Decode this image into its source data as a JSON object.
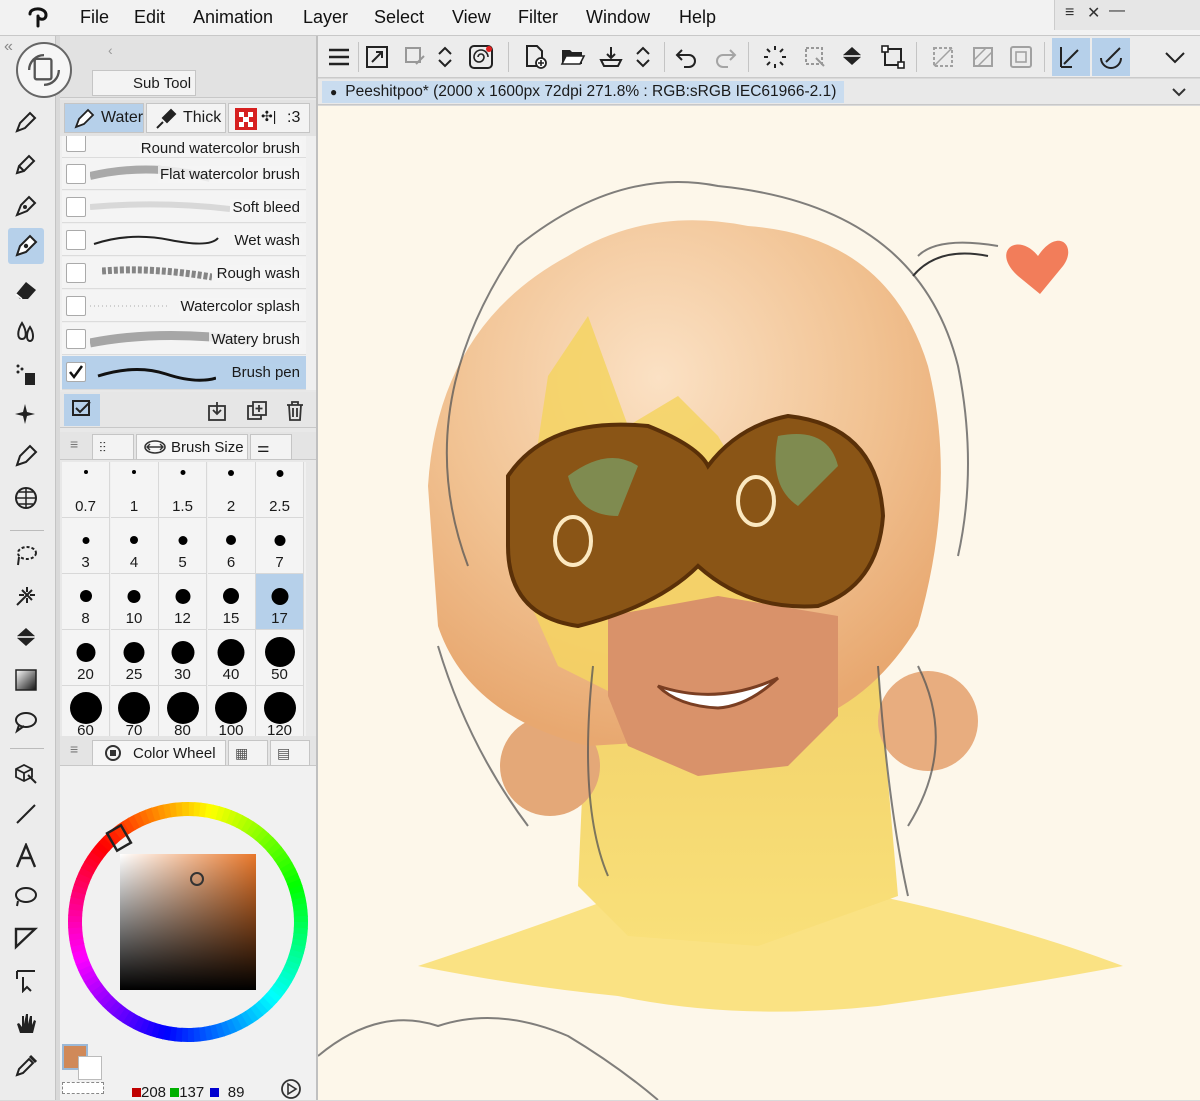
{
  "menubar": {
    "items": [
      "File",
      "Edit",
      "Animation",
      "Layer",
      "Select",
      "View",
      "Filter",
      "Window",
      "Help"
    ]
  },
  "subtool_panel": {
    "header_label": "Sub Tool",
    "tabs": [
      "Waterc",
      "Thick",
      ":3"
    ],
    "brushes": [
      {
        "name": "Round watercolor brush",
        "checked": false,
        "selected": false
      },
      {
        "name": "Flat watercolor brush",
        "checked": false,
        "selected": false
      },
      {
        "name": "Soft bleed",
        "checked": false,
        "selected": false
      },
      {
        "name": "Wet wash",
        "checked": false,
        "selected": false
      },
      {
        "name": "Rough wash",
        "checked": false,
        "selected": false
      },
      {
        "name": "Watercolor splash",
        "checked": false,
        "selected": false
      },
      {
        "name": "Watery brush",
        "checked": false,
        "selected": false
      },
      {
        "name": "Brush pen",
        "checked": true,
        "selected": true
      }
    ]
  },
  "brush_size_panel": {
    "label": "Brush Size",
    "sizes": [
      "0.7",
      "1",
      "1.5",
      "2",
      "2.5",
      "3",
      "4",
      "5",
      "6",
      "7",
      "8",
      "10",
      "12",
      "15",
      "17",
      "20",
      "25",
      "30",
      "40",
      "50",
      "60",
      "70",
      "80",
      "100",
      "120"
    ],
    "selected": "17"
  },
  "color_panel": {
    "label": "Color Wheel",
    "rgb": {
      "r": "208",
      "g": "137",
      "b": "89"
    },
    "main_color": "#d08959",
    "sub_color": "#ffffff",
    "hue_color": "#e8772a"
  },
  "document": {
    "title": "Peeshitpoo* (2000 x 1600px 72dpi 271.8% : RGB:sRGB IEC61966-2.1)"
  },
  "colors": {
    "accent": "#b6d0ea",
    "canvas_bg": "#fdf7ea"
  }
}
